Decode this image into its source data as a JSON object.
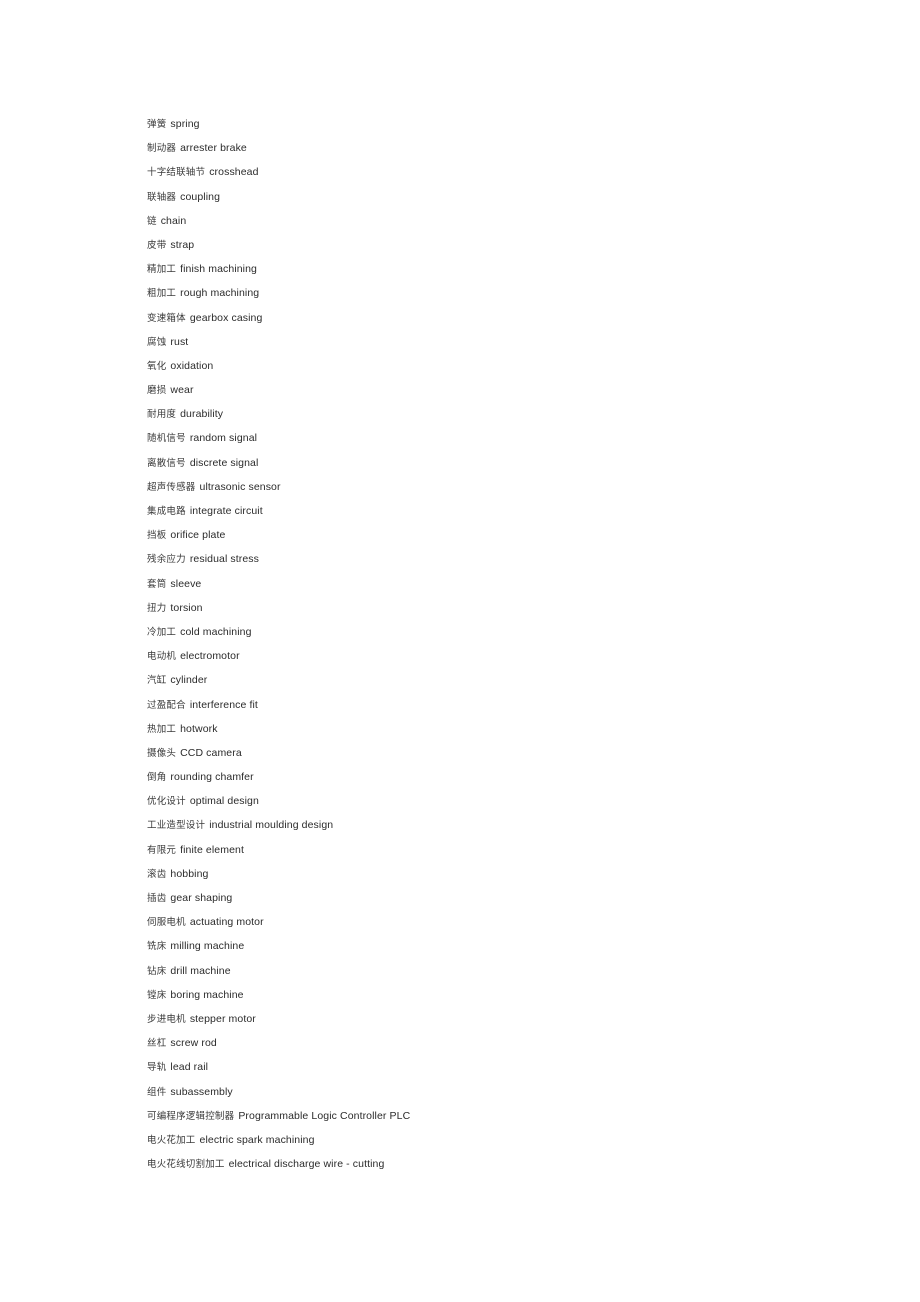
{
  "document": {
    "background_color": "#ffffff",
    "text_color": "#2a2a2a",
    "entries": [
      {
        "cn": "弹簧",
        "en": "spring"
      },
      {
        "cn": "制动器",
        "en": "arrester brake"
      },
      {
        "cn": "十字结联轴节",
        "en": "crosshead"
      },
      {
        "cn": "联轴器",
        "en": "coupling"
      },
      {
        "cn": "链",
        "en": "chain"
      },
      {
        "cn": "皮带",
        "en": "strap"
      },
      {
        "cn": "精加工",
        "en": "finish machining"
      },
      {
        "cn": "粗加工",
        "en": "rough machining"
      },
      {
        "cn": "变速箱体",
        "en": "gearbox casing"
      },
      {
        "cn": "腐蚀",
        "en": "rust"
      },
      {
        "cn": "氧化",
        "en": "oxidation"
      },
      {
        "cn": "磨损",
        "en": "wear"
      },
      {
        "cn": "耐用度",
        "en": "durability"
      },
      {
        "cn": "随机信号",
        "en": "random signal"
      },
      {
        "cn": "离散信号",
        "en": "discrete signal"
      },
      {
        "cn": "超声传感器",
        "en": "ultrasonic sensor"
      },
      {
        "cn": "集成电路",
        "en": "integrate circuit"
      },
      {
        "cn": "挡板",
        "en": "orifice plate"
      },
      {
        "cn": "残余应力",
        "en": "residual stress"
      },
      {
        "cn": "套筒",
        "en": "sleeve"
      },
      {
        "cn": "扭力",
        "en": "torsion"
      },
      {
        "cn": "冷加工",
        "en": "cold machining"
      },
      {
        "cn": "电动机",
        "en": "electromotor"
      },
      {
        "cn": "汽缸",
        "en": "cylinder"
      },
      {
        "cn": "过盈配合",
        "en": "interference fit"
      },
      {
        "cn": "热加工",
        "en": "hotwork"
      },
      {
        "cn": "摄像头",
        "en": "CCD camera"
      },
      {
        "cn": "倒角",
        "en": "rounding chamfer"
      },
      {
        "cn": "优化设计",
        "en": "optimal design"
      },
      {
        "cn": "工业造型设计",
        "en": "industrial moulding design"
      },
      {
        "cn": "有限元",
        "en": "finite element"
      },
      {
        "cn": "滚齿",
        "en": "hobbing"
      },
      {
        "cn": "插齿",
        "en": "gear shaping"
      },
      {
        "cn": "伺服电机",
        "en": "actuating motor"
      },
      {
        "cn": "铣床",
        "en": "milling machine"
      },
      {
        "cn": "钻床",
        "en": "drill machine"
      },
      {
        "cn": "镗床",
        "en": "boring machine"
      },
      {
        "cn": "步进电机",
        "en": "stepper motor"
      },
      {
        "cn": "丝杠",
        "en": "screw rod"
      },
      {
        "cn": "导轨",
        "en": "lead rail"
      },
      {
        "cn": "组件",
        "en": "subassembly"
      },
      {
        "cn": "可编程序逻辑控制器",
        "en": "Programmable Logic Controller PLC"
      },
      {
        "cn": "电火花加工",
        "en": "electric spark machining"
      },
      {
        "cn": "电火花线切割加工",
        "en": "electrical discharge wire - cutting"
      }
    ]
  }
}
